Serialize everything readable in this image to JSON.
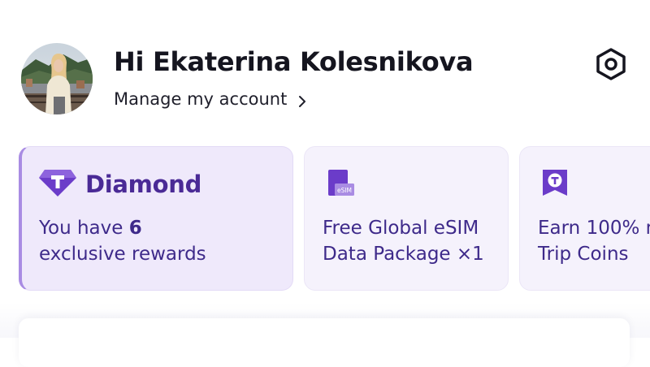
{
  "profile": {
    "greeting": "Hi Ekaterina Kolesnikova",
    "manage_label": "Manage my account",
    "avatar_icon": "user-photo",
    "settings_icon": "settings-gear-icon"
  },
  "cards": {
    "diamond": {
      "tier_label": "Diamond",
      "line1_prefix": "You have ",
      "count": "6",
      "line2": "exclusive rewards",
      "icon": "diamond-badge-icon"
    },
    "esim": {
      "icon_label": "eSIM",
      "line1": "Free Global eSIM",
      "line2": "Data Package ×1",
      "icon": "esim-card-icon"
    },
    "coins": {
      "line1": "Earn 100% m",
      "line2": "Trip Coins",
      "icon": "trip-coin-badge-icon"
    }
  },
  "colors": {
    "accent_purple": "#4a2a96",
    "card_text": "#3e2a8a",
    "card_bg_active": "#efe9fb",
    "card_bg": "#f5f2fc",
    "active_stripe": "#a98ce3"
  }
}
